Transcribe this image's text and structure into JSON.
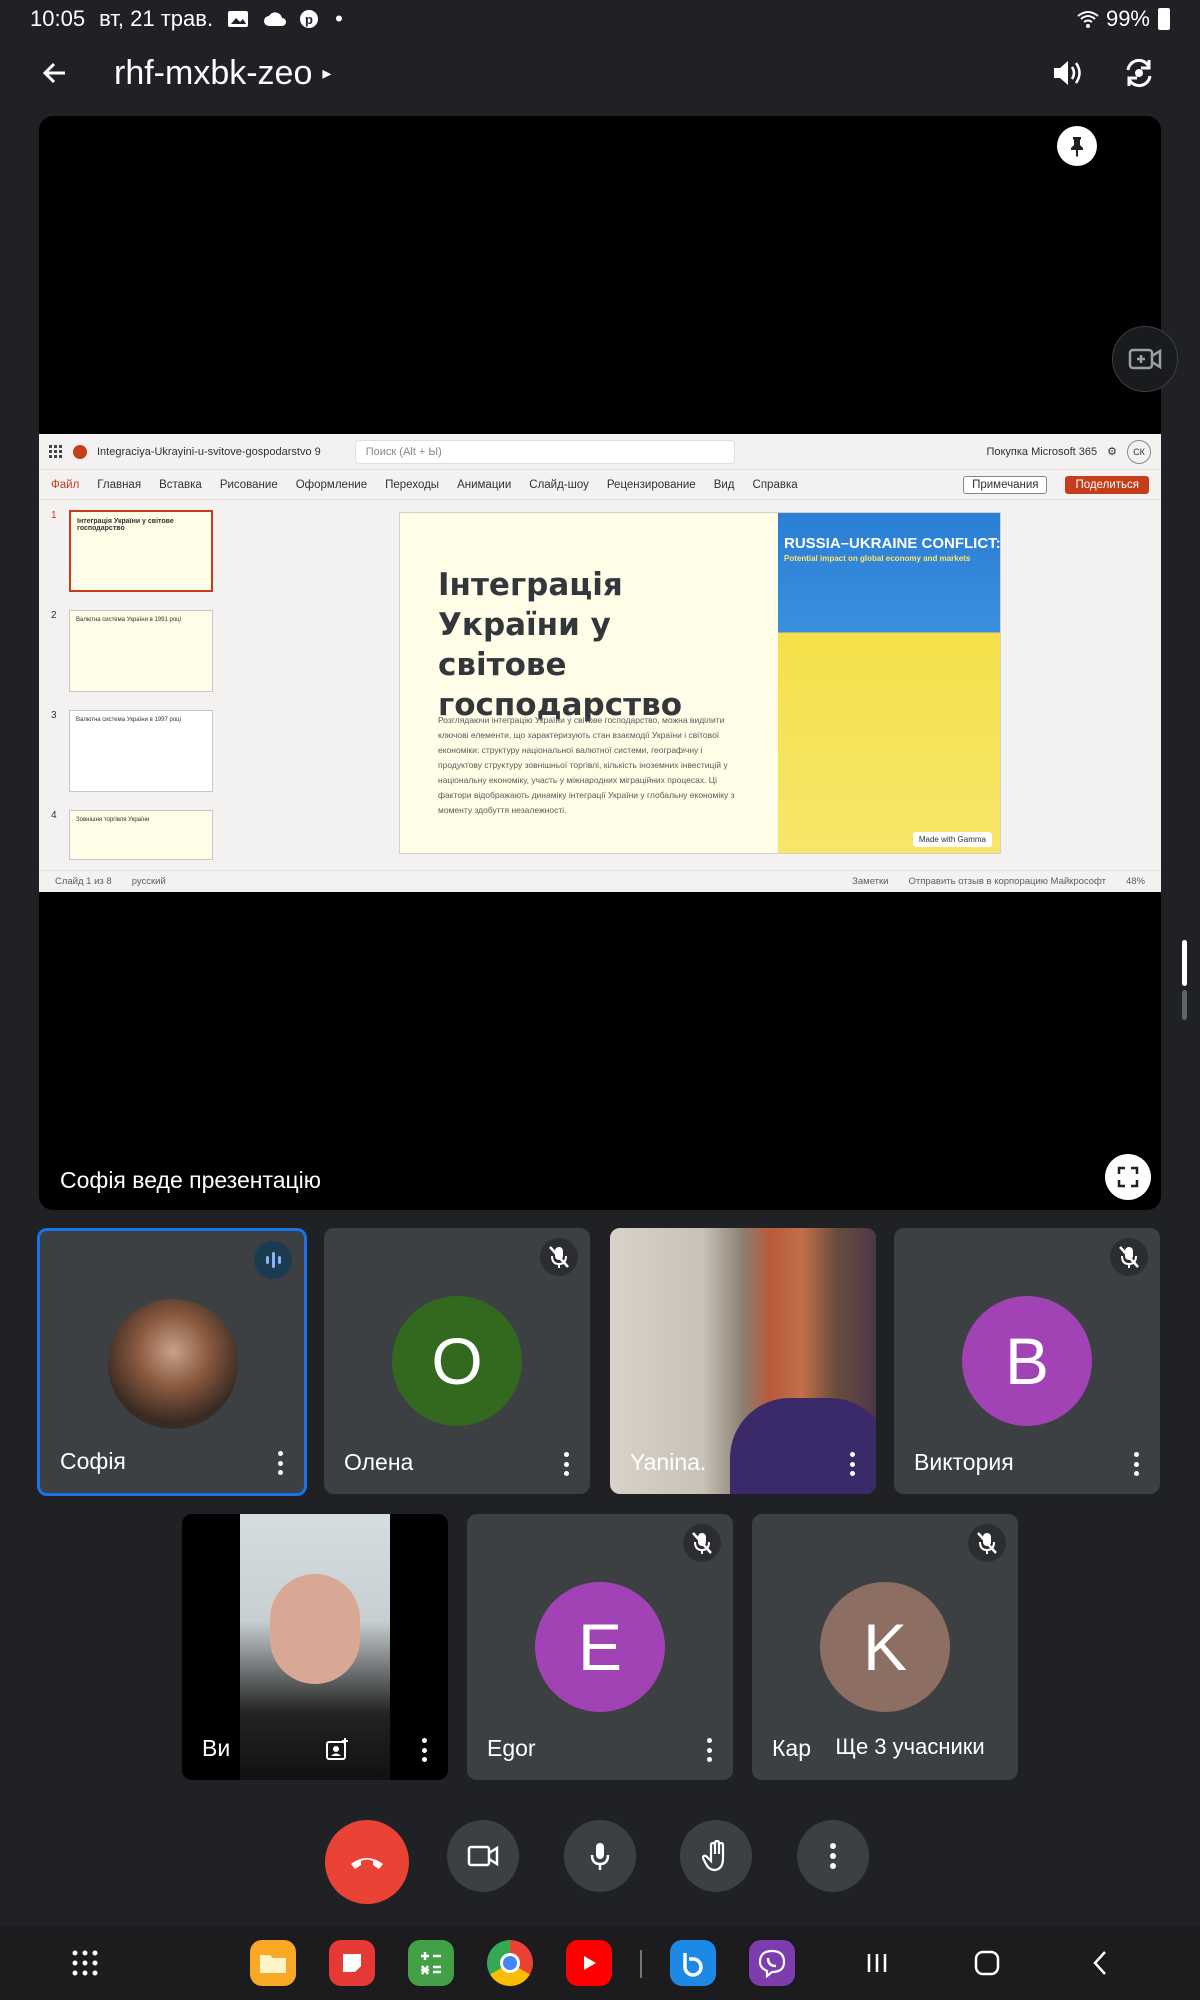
{
  "status_bar": {
    "time": "10:05",
    "date": "вт, 21 трав.",
    "battery": "99%",
    "icons": [
      "gallery-icon",
      "cloud-icon",
      "pinterest-icon",
      "dot-icon",
      "wifi-icon",
      "battery-icon"
    ]
  },
  "header": {
    "meeting_code": "rhf-mxbk-zeo",
    "caret": "▸"
  },
  "presentation": {
    "presenter_label": "Софія веде презентацію"
  },
  "ppt": {
    "doc_name": "Integraciya-Ukrayini-u-svitove-gospodarstvo 9",
    "search_placeholder": "Поиск (Alt + Ы)",
    "buy_label": "Покупка Microsoft 365",
    "avatar_initials": "СК",
    "menu": [
      "Файл",
      "Главная",
      "Вставка",
      "Рисование",
      "Оформление",
      "Переходы",
      "Анимации",
      "Слайд-шоу",
      "Рецензирование",
      "Вид",
      "Справка"
    ],
    "comments_label": "Примечания",
    "share_label": "Поделиться",
    "thumb_numbers": [
      "1",
      "2",
      "3",
      "4"
    ],
    "thumb_titles": [
      "Інтеграція України у світове господарство",
      "Валютна система України в 1991 році",
      "Валютна система України в 1997 році",
      "Зовнішня торгівля України"
    ],
    "slide_title": "Інтеграція України у світове господарство",
    "slide_text": "Розглядаючи інтеграцію України у світове господарство, можна виділити ключові елементи, що характеризують стан взаємодії України і світової економіки: структуру національної валютної системи, географічну і продуктову структуру зовнішньої торгівлі, кількість іноземних інвестицій у національну економіку, участь у міжнародних міграційних процесах. Ці фактори відображають динаміку інтеграції України у глобальну економіку з моменту здобуття незалежності.",
    "image_title": "RUSSIA–UKRAINE CONFLICT:",
    "image_subtitle": "Potential impact on global economy and markets",
    "gamma_badge": "Made with Gamma",
    "status_slide": "Слайд 1 из 8",
    "status_lang": "русский",
    "status_notes": "Заметки",
    "status_feedback": "Отправить отзыв в корпорацию Майкрософт",
    "status_zoom": "48%"
  },
  "participants": [
    {
      "name": "Софія",
      "type": "photo",
      "state": "speaking"
    },
    {
      "name": "Олена",
      "initial": "О",
      "color": "#33691e",
      "state": "muted"
    },
    {
      "name": "Yanina.",
      "type": "video",
      "state": "on"
    },
    {
      "name": "Виктория",
      "initial": "В",
      "color": "#a142b5",
      "state": "muted"
    },
    {
      "name": "Ви",
      "type": "video",
      "state": "self"
    },
    {
      "name": "Egor",
      "initial": "E",
      "color": "#a142b5",
      "state": "muted"
    },
    {
      "name": "Кар",
      "initial": "K",
      "color": "#8d6e63",
      "state": "muted"
    }
  ],
  "more_participants": "Ще 3 учасники",
  "controls": [
    "end-call",
    "camera",
    "microphone",
    "raise-hand",
    "more-options"
  ],
  "nav_apps": [
    "apps-grid-icon",
    "files-app",
    "notes-app",
    "calculator-app",
    "chrome-app",
    "youtube-app",
    "bixby-app",
    "viber-app"
  ],
  "colors": {
    "end_call": "#ea4335",
    "tile_bg": "#3c4043",
    "active_border": "#1a73e8",
    "ppt_accent": "#c43e1c"
  }
}
